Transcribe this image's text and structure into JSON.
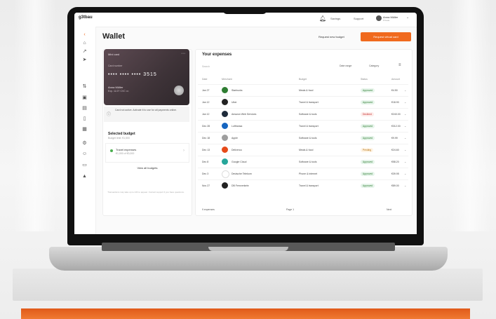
{
  "header": {
    "logo": "g3tbau",
    "link_1": "Savings",
    "link_2": "Support",
    "user_name": "Anna Müller",
    "user_sub": "Private"
  },
  "page": {
    "title": "Wallet",
    "secondary_button": "Request new budget",
    "primary_button": "Request virtual card"
  },
  "card": {
    "label": "Mini card",
    "sub_label": "Card number",
    "number": "•••• •••• •••• 3515",
    "holder": "Anna Müller",
    "expiry": "Exp. 11/27   CVC •••"
  },
  "info_box": {
    "text": "Card not active. Activate it to use for all payments online."
  },
  "budgets": {
    "title": "Selected budget",
    "subtitle": "Budget limit: €1,500",
    "item_name": "Travel expenses",
    "item_amount": "€1,000 of €3,000",
    "link": "View all budgets"
  },
  "footer_note": "Transactions may take up to 24h to appear. Contact support if you have questions.",
  "table": {
    "title": "Your expenses",
    "search_placeholder": "Search",
    "filter_a": "Date range",
    "filter_b": "Category",
    "columns": [
      "Date",
      "Merchant",
      "Budget",
      "Status",
      "Amount"
    ],
    "rows": [
      {
        "date": "Jan 27",
        "merchant": "Starbucks",
        "budget": "Meals & food",
        "status": "Approved",
        "amount": "€4.50",
        "icon_color": "#2e7d32",
        "status_type": "ok"
      },
      {
        "date": "Jan 12",
        "merchant": "Uber",
        "budget": "Travel & transport",
        "status": "Approved",
        "amount": "€18.90",
        "icon_color": "#222222",
        "status_type": "ok"
      },
      {
        "date": "Jan 12",
        "merchant": "Amazon Web Services",
        "budget": "Software & tools",
        "status": "Declined",
        "amount": "€240.00",
        "icon_color": "#1e2a3a",
        "status_type": "bad"
      },
      {
        "date": "Dec 28",
        "merchant": "Lufthansa",
        "budget": "Travel & transport",
        "status": "Approved",
        "amount": "€312.00",
        "icon_color": "#1565c0",
        "status_type": "ok"
      },
      {
        "date": "Dec 18",
        "merchant": "Apple",
        "budget": "Software & tools",
        "status": "Approved",
        "amount": "€9.99",
        "icon_color": "#9e9e9e",
        "status_type": "ok"
      },
      {
        "date": "Dec 13",
        "merchant": "Deliveroo",
        "budget": "Meals & food",
        "status": "Pending",
        "amount": "€24.60",
        "icon_color": "#e64a19",
        "status_type": "pending"
      },
      {
        "date": "Dec 8",
        "merchant": "Google Cloud",
        "budget": "Software & tools",
        "status": "Approved",
        "amount": "€58.20",
        "icon_color": "#26a69a",
        "status_type": "ok"
      },
      {
        "date": "Dec 3",
        "merchant": "Deutsche Telekom",
        "budget": "Phone & internet",
        "status": "Approved",
        "amount": "€39.95",
        "icon_color": "#ffffff",
        "status_type": "ok"
      },
      {
        "date": "Nov 27",
        "merchant": "DB Fernverkehr",
        "budget": "Travel & transport",
        "status": "Approved",
        "amount": "€89.00",
        "icon_color": "#222222",
        "status_type": "ok"
      }
    ],
    "footer_left": "9 expenses",
    "footer_mid": "Page 1",
    "footer_right": "Next"
  },
  "colors": {
    "accent": "#f06a1e",
    "ok_bg": "#e6f4ea",
    "ok_fg": "#2e7d32",
    "bad_bg": "#fdecea",
    "bad_fg": "#c62828",
    "pending_bg": "#fff4e5",
    "pending_fg": "#b26a00"
  }
}
